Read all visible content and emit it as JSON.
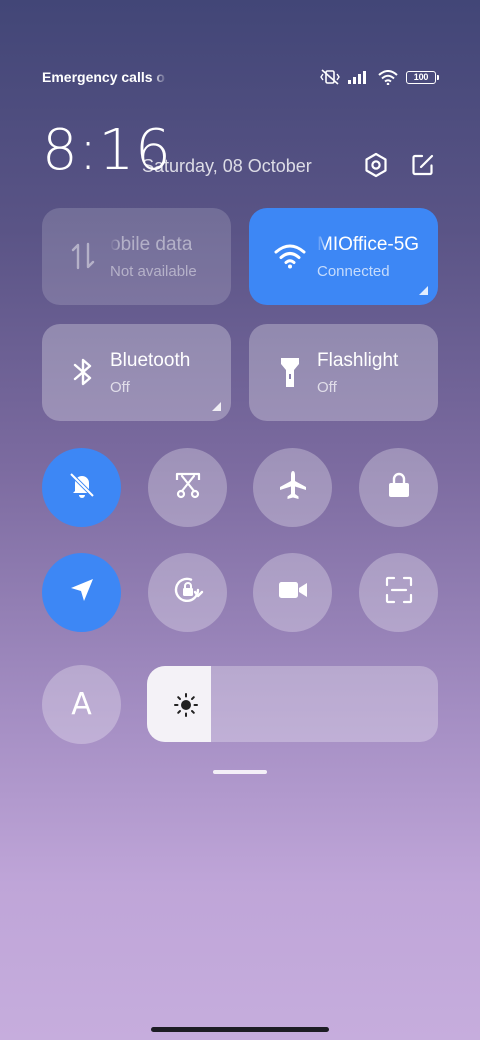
{
  "status_bar": {
    "carrier_text": "Emergency calls o",
    "battery_level": "100",
    "icons": [
      "mute-vibrate-icon",
      "signal-icon",
      "wifi-icon",
      "battery-icon"
    ]
  },
  "header": {
    "time": "8:16",
    "date": "Saturday, 08 October",
    "icons": [
      "settings-icon",
      "edit-icon"
    ]
  },
  "tiles": [
    {
      "name": "obile data",
      "state": "Not available",
      "icon": "mobile-data-icon",
      "status": "disabled"
    },
    {
      "name": "MIOffice-5G",
      "state": "Connected",
      "icon": "wifi-icon",
      "status": "active"
    },
    {
      "name": "Bluetooth",
      "state": "Off",
      "icon": "bluetooth-icon",
      "status": "inactive"
    },
    {
      "name": "Flashlight",
      "state": "Off",
      "icon": "flashlight-icon",
      "status": "inactive"
    }
  ],
  "toggles_row1": [
    {
      "icon": "silent-bell-icon",
      "active": true
    },
    {
      "icon": "screenshot-icon",
      "active": false
    },
    {
      "icon": "airplane-icon",
      "active": false
    },
    {
      "icon": "lock-icon",
      "active": false
    }
  ],
  "toggles_row2": [
    {
      "icon": "location-icon",
      "active": true
    },
    {
      "icon": "rotation-lock-icon",
      "active": false
    },
    {
      "icon": "screen-record-icon",
      "active": false
    },
    {
      "icon": "scan-icon",
      "active": false
    }
  ],
  "auto_brightness_label": "A",
  "brightness": {
    "level_fraction": 0.22,
    "icon": "sun-icon"
  },
  "colors": {
    "accent": "#3d87f5",
    "tile_bg": "rgba(255,255,255,0.28)",
    "text": "#ffffff"
  }
}
